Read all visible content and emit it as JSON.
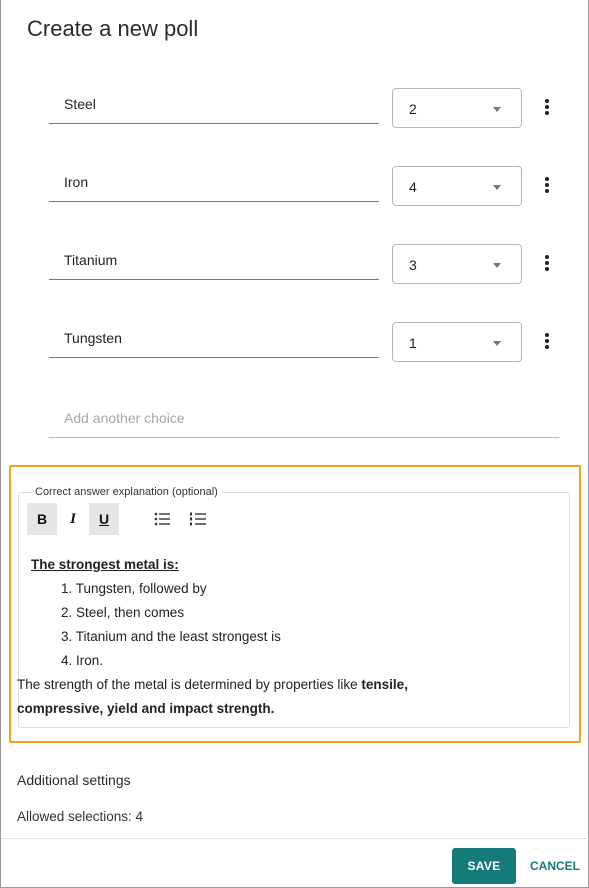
{
  "dialog": {
    "title": "Create a new poll"
  },
  "choices": [
    {
      "text": "Steel",
      "rank": "2"
    },
    {
      "text": "Iron",
      "rank": "4"
    },
    {
      "text": "Titanium",
      "rank": "3"
    },
    {
      "text": "Tungsten",
      "rank": "1"
    }
  ],
  "add_choice": {
    "placeholder": "Add another choice"
  },
  "explanation": {
    "legend": "Correct answer explanation (optional)",
    "toolbar": {
      "bold": "B",
      "italic": "I",
      "underline": "U",
      "bullet_icon": "bulleted-list-icon",
      "number_icon": "numbered-list-icon"
    },
    "heading": "The strongest metal is:",
    "list": [
      "1. Tungsten, followed by",
      "2. Steel, then comes",
      "3. Titanium and the least strongest is",
      "4. Iron."
    ],
    "para_prefix": "The strength of the metal is determined by properties like ",
    "para_bold_1": "tensile,",
    "para_bold_2": "compressive, yield and impact strength."
  },
  "settings": {
    "heading": "Additional settings",
    "allowed_selections": "Allowed selections: 4"
  },
  "footer": {
    "save_label": "SAVE",
    "cancel_label": "CANCEL"
  },
  "colors": {
    "accent": "#147a7a",
    "highlight": "#f0a020"
  }
}
